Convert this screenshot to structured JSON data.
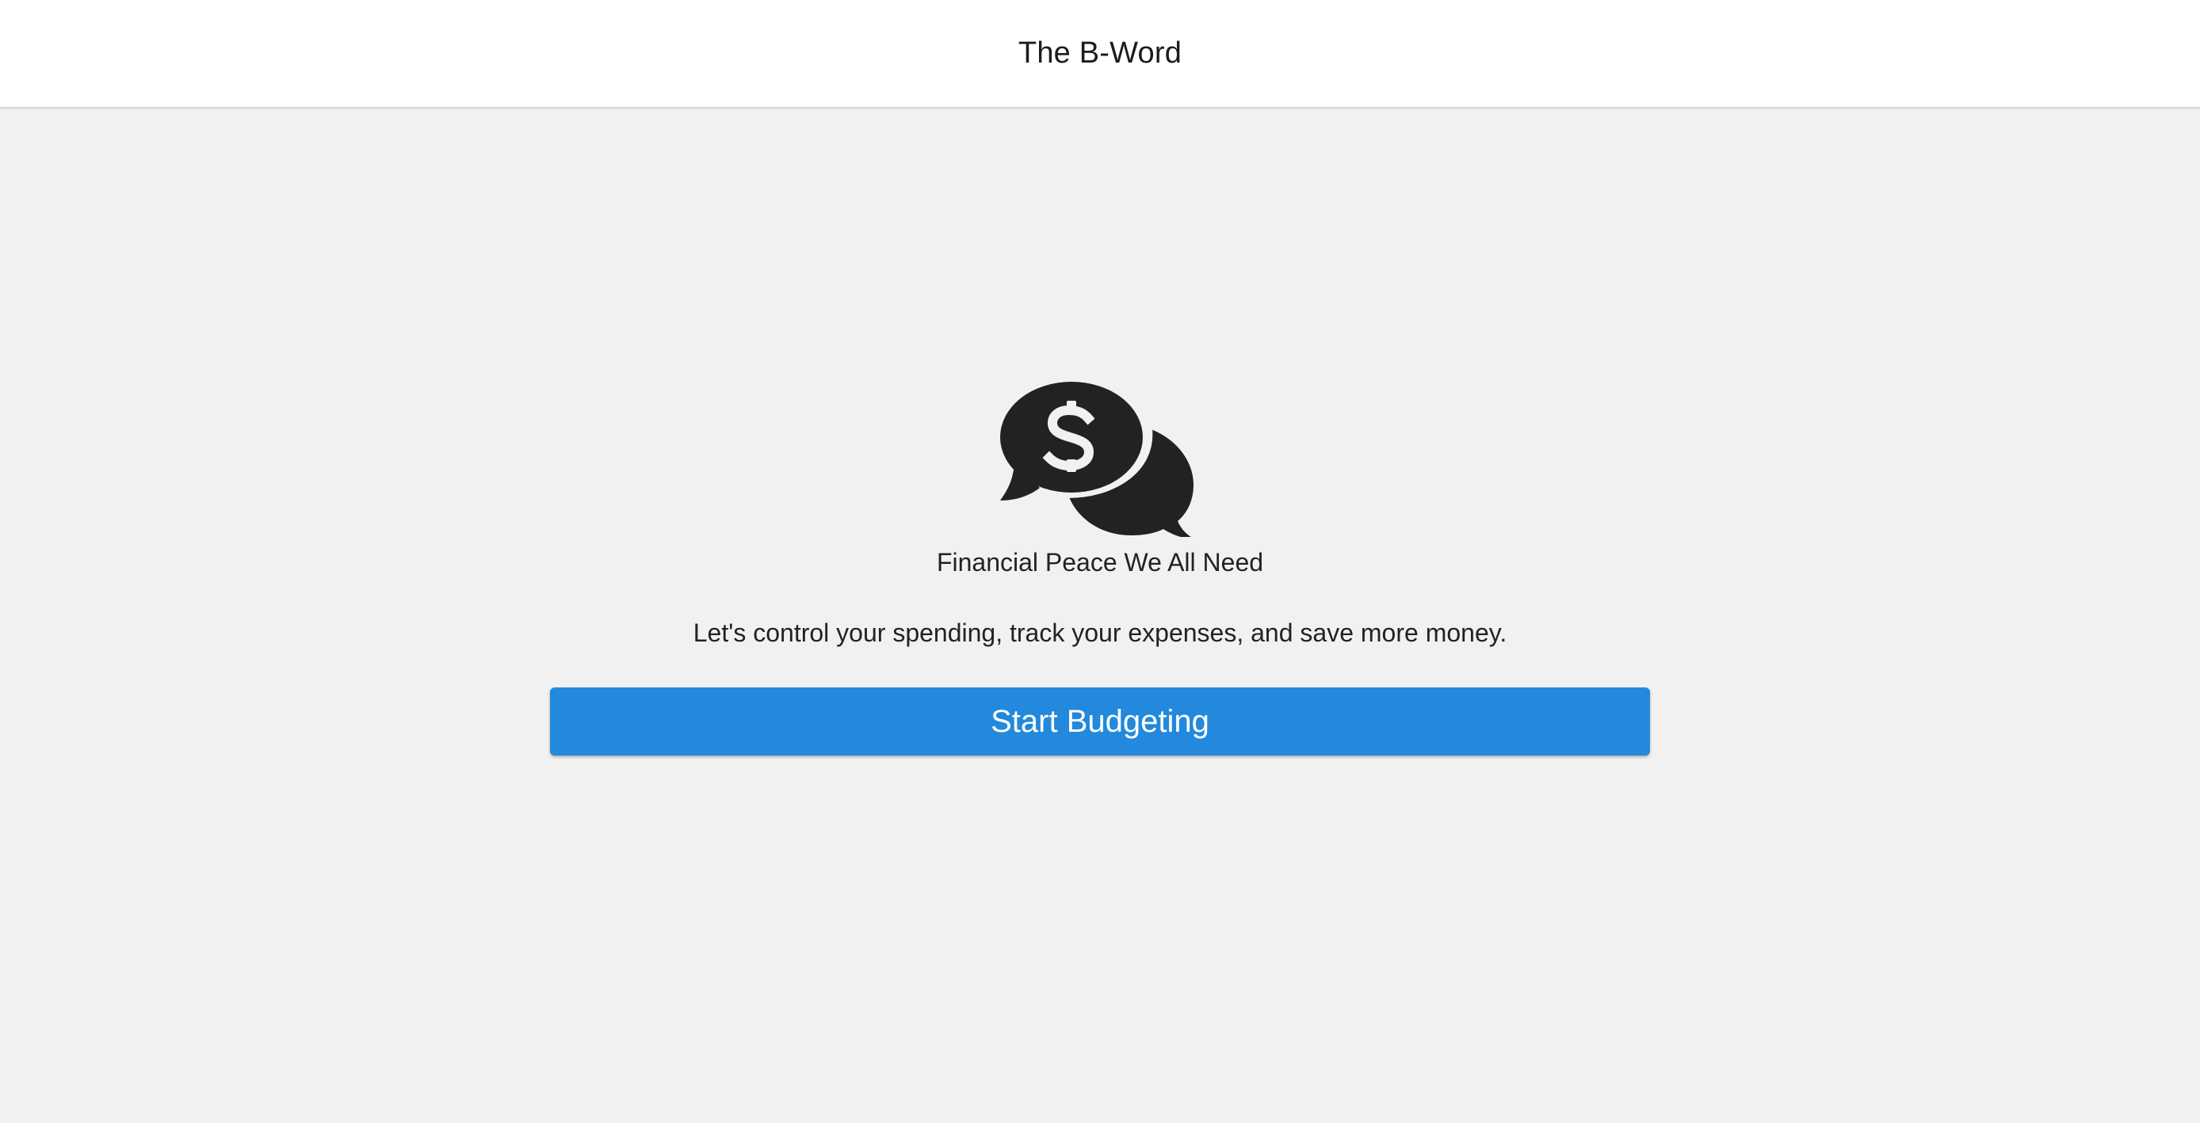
{
  "header": {
    "title": "The B-Word"
  },
  "hero": {
    "icon": "comments-dollar-icon",
    "icon_color": "#222222",
    "tagline": "Financial Peace We All Need",
    "description": "Let's control your spending, track your expenses, and save more money."
  },
  "cta": {
    "label": "Start Budgeting",
    "color": "#2289dc"
  }
}
